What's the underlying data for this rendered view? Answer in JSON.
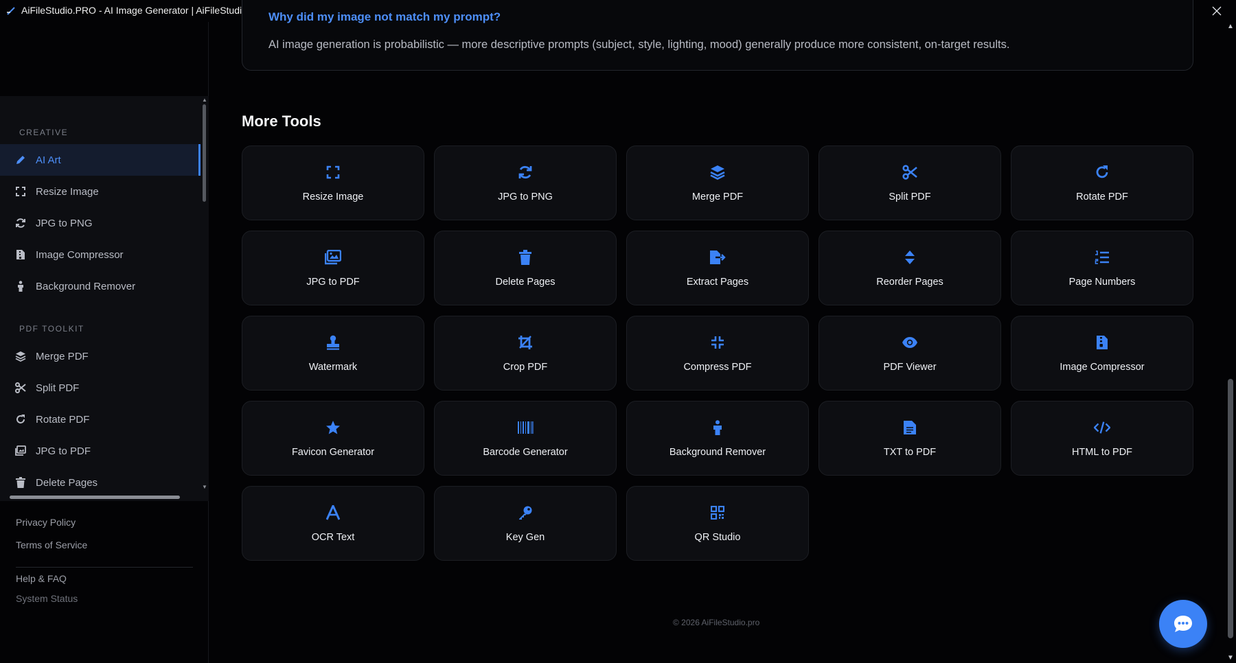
{
  "window": {
    "title": "AiFileStudio.PRO - AI Image Generator | AiFileStudio.PRO",
    "app_icon": "pen-logo-icon",
    "buttons": [
      "extension-icon",
      "download-icon",
      "more-vert-icon",
      "minimize-icon",
      "restore-icon",
      "close-icon"
    ]
  },
  "colors": {
    "accent": "#3b82f6",
    "background": "#030305",
    "card": "#0d0e12",
    "text_muted": "#b9bcc5"
  },
  "sidebar": {
    "sections": [
      {
        "label": "CREATIVE",
        "items": [
          {
            "label": "AI Art",
            "icon": "pencil-icon",
            "active": true
          },
          {
            "label": "Resize Image",
            "icon": "expand-icon"
          },
          {
            "label": "JPG to PNG",
            "icon": "sync-icon"
          },
          {
            "label": "Image Compressor",
            "icon": "file-zipper-icon"
          },
          {
            "label": "Background Remover",
            "icon": "person-icon"
          }
        ]
      },
      {
        "label": "PDF TOOLKIT",
        "items": [
          {
            "label": "Merge PDF",
            "icon": "layers-icon"
          },
          {
            "label": "Split PDF",
            "icon": "scissors-icon"
          },
          {
            "label": "Rotate PDF",
            "icon": "rotate-icon"
          },
          {
            "label": "JPG to PDF",
            "icon": "images-icon"
          },
          {
            "label": "Delete Pages",
            "icon": "trash-icon"
          }
        ]
      }
    ],
    "footer_links": [
      "Privacy Policy",
      "Terms of Service",
      "Help & FAQ",
      "System Status"
    ]
  },
  "faq": {
    "question": "Why did my image not match my prompt?",
    "answer": "AI image generation is probabilistic — more descriptive prompts (subject, style, lighting, mood) generally produce more consistent, on-target results."
  },
  "more_tools": {
    "title": "More Tools",
    "tools": [
      {
        "label": "Resize Image",
        "icon": "expand-icon"
      },
      {
        "label": "JPG to PNG",
        "icon": "sync-icon"
      },
      {
        "label": "Merge PDF",
        "icon": "layers-icon"
      },
      {
        "label": "Split PDF",
        "icon": "scissors-icon"
      },
      {
        "label": "Rotate PDF",
        "icon": "rotate-icon"
      },
      {
        "label": "JPG to PDF",
        "icon": "images-icon"
      },
      {
        "label": "Delete Pages",
        "icon": "trash-icon"
      },
      {
        "label": "Extract Pages",
        "icon": "file-export-icon"
      },
      {
        "label": "Reorder Pages",
        "icon": "sort-icon"
      },
      {
        "label": "Page Numbers",
        "icon": "list-ol-icon"
      },
      {
        "label": "Watermark",
        "icon": "stamp-icon"
      },
      {
        "label": "Crop PDF",
        "icon": "crop-icon"
      },
      {
        "label": "Compress PDF",
        "icon": "compress-icon"
      },
      {
        "label": "PDF Viewer",
        "icon": "eye-icon"
      },
      {
        "label": "Image Compressor",
        "icon": "file-zipper-icon"
      },
      {
        "label": "Favicon Generator",
        "icon": "star-icon"
      },
      {
        "label": "Barcode Generator",
        "icon": "barcode-icon"
      },
      {
        "label": "Background Remover",
        "icon": "person-icon"
      },
      {
        "label": "TXT to PDF",
        "icon": "file-lines-icon"
      },
      {
        "label": "HTML to PDF",
        "icon": "code-icon"
      },
      {
        "label": "OCR Text",
        "icon": "font-icon"
      },
      {
        "label": "Key Gen",
        "icon": "key-icon"
      },
      {
        "label": "QR Studio",
        "icon": "qrcode-icon"
      }
    ]
  },
  "footer": {
    "copyright": "© 2026 AiFileStudio.pro"
  },
  "chat": {
    "icon": "chat-bubble-icon"
  }
}
